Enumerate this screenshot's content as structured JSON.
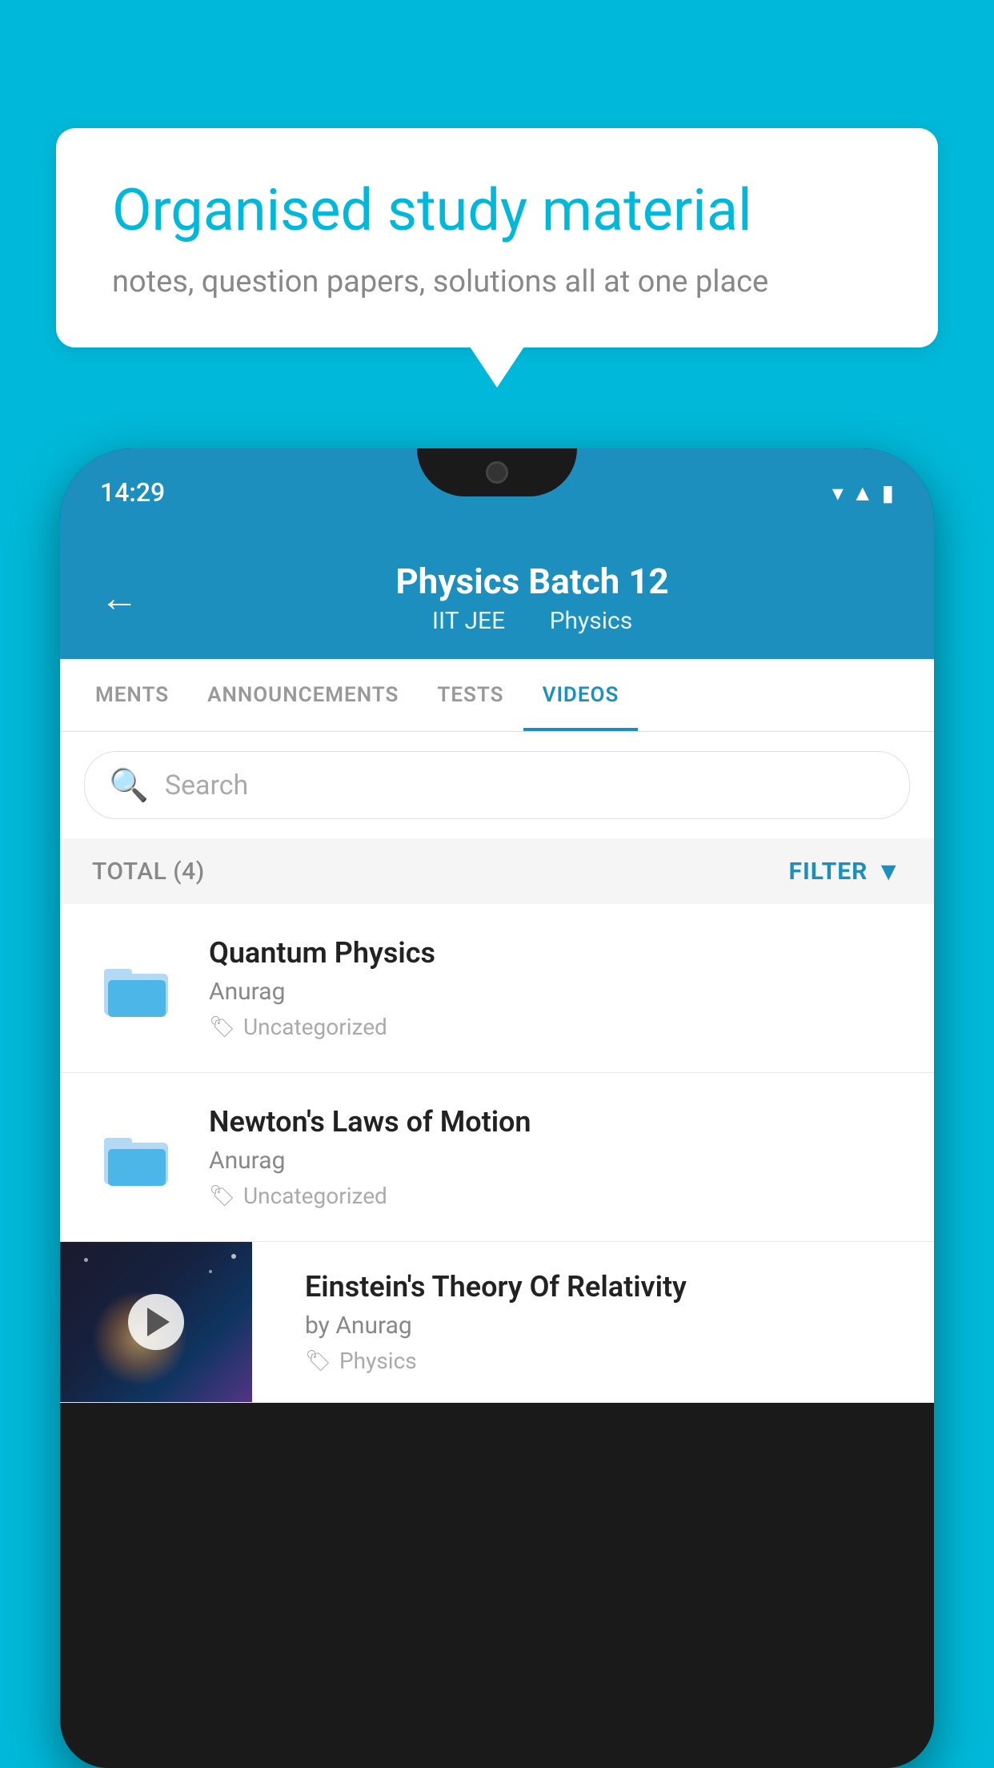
{
  "background_color": "#00b8d9",
  "speech_bubble": {
    "title": "Organised study material",
    "subtitle": "notes, question papers, solutions all at one place"
  },
  "phone": {
    "status_bar": {
      "time": "14:29"
    },
    "header": {
      "title": "Physics Batch 12",
      "subtitle1": "IIT JEE",
      "subtitle2": "Physics",
      "back_label": "←"
    },
    "tabs": [
      {
        "label": "MENTS",
        "active": false
      },
      {
        "label": "ANNOUNCEMENTS",
        "active": false
      },
      {
        "label": "TESTS",
        "active": false
      },
      {
        "label": "VIDEOS",
        "active": true
      }
    ],
    "search": {
      "placeholder": "Search"
    },
    "filter_bar": {
      "total_label": "TOTAL (4)",
      "filter_label": "FILTER"
    },
    "videos": [
      {
        "title": "Quantum Physics",
        "author": "Anurag",
        "tag": "Uncategorized",
        "type": "folder"
      },
      {
        "title": "Newton's Laws of Motion",
        "author": "Anurag",
        "tag": "Uncategorized",
        "type": "folder"
      },
      {
        "title": "Einstein's Theory Of Relativity",
        "author_prefix": "by",
        "author": "Anurag",
        "tag": "Physics",
        "type": "video"
      }
    ]
  }
}
